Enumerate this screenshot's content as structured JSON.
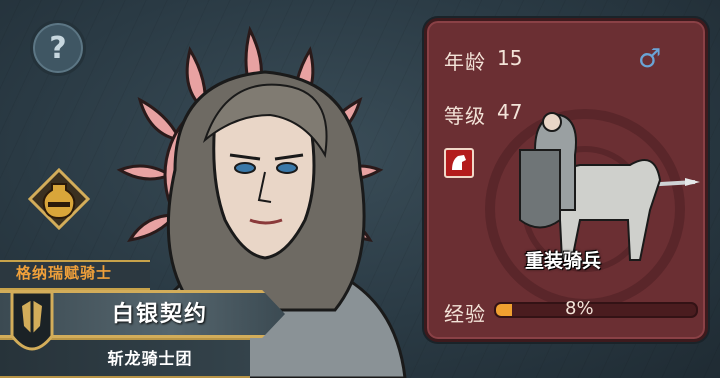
{
  "help": {
    "icon": "question-icon",
    "glyph": "?"
  },
  "hero": {
    "order": "格纳瑞赋骑士",
    "name": "白银契约",
    "faction": "斩龙骑士团"
  },
  "stats": {
    "age_label": "年龄",
    "age_value": "15",
    "gender_icon": "male-icon",
    "gender_glyph": "♂",
    "level_label": "等级",
    "level_value": "47",
    "unit_type_icon": "cavalry-icon",
    "unit_name": "重装骑兵",
    "xp_label": "经验",
    "xp_value": "8%",
    "xp_fraction": 0.08
  },
  "colors": {
    "panel": "#6b2f33",
    "emblem": "#e8a2a2",
    "xp_fill": "#f0a030",
    "order_text": "#f0a03a"
  }
}
